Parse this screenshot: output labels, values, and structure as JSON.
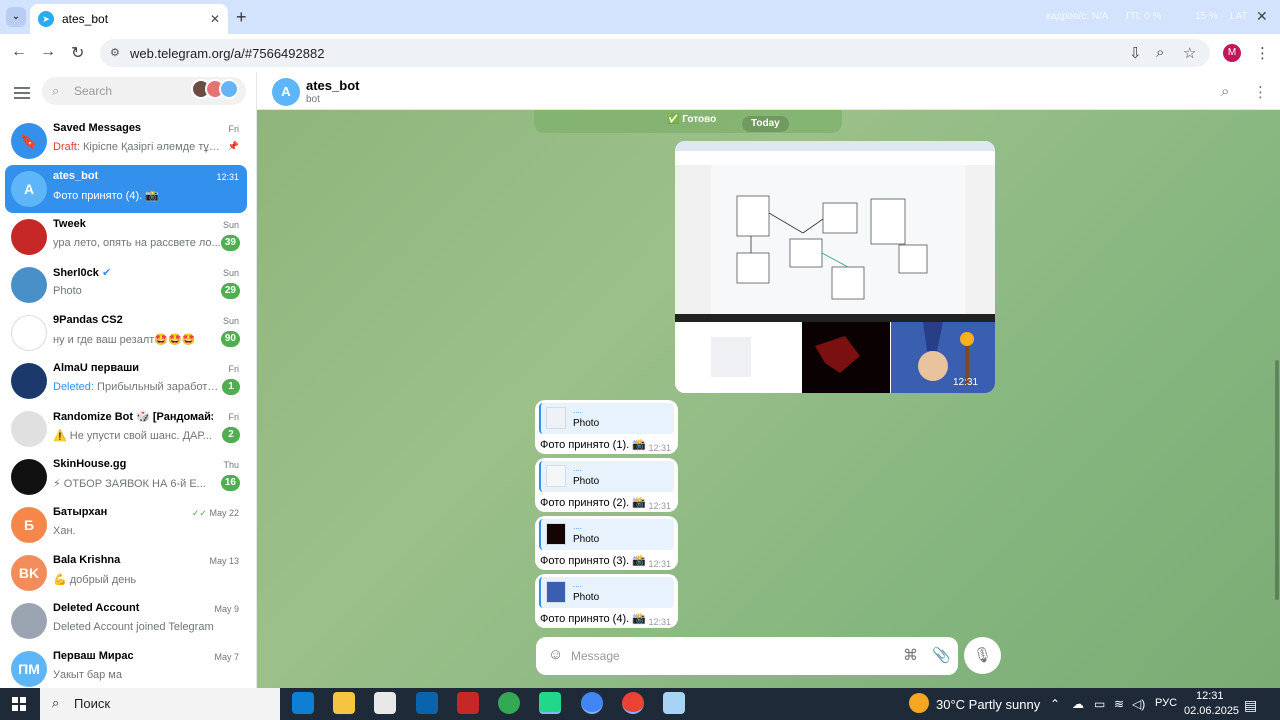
{
  "browser": {
    "tab_title": "ates_bot",
    "url": "web.telegram.org/a/#7566492882",
    "profile_initial": "M",
    "status_overlay": [
      "кадров/с: N/A",
      "ГП: 0 %",
      "15 %",
      "LAT"
    ]
  },
  "sidebar": {
    "search_placeholder": "Search",
    "chats": [
      {
        "name": "Saved Messages",
        "date": "Fri",
        "prefix": "Draft:",
        "preview": " Кіріспе Қазіргі әлемде тұр...",
        "avatar_color": "#3390ec",
        "avatar_text": "",
        "icon": "bookmark-icon"
      },
      {
        "name": "ates_bot",
        "date": "12:31",
        "preview": "Фото принято (4). 📸",
        "avatar_color": "#5eb5f7",
        "avatar_text": "A",
        "active": true
      },
      {
        "name": "Tweek",
        "date": "Sun",
        "preview": "ура лето, опять на рассвете ло...",
        "badge": "39",
        "avatar_color": "#c62828",
        "avatar_text": ""
      },
      {
        "name": "Sherl0ck",
        "date": "Sun",
        "preview": "Photo",
        "badge": "29",
        "avatar_color": "#4a90c8",
        "avatar_text": "",
        "verified": true
      },
      {
        "name": "9Pandas CS2",
        "date": "Sun",
        "preview": "ну и где ваш резалт🤩🤩🤩",
        "badge": "90",
        "avatar_color": "#ffffff",
        "avatar_text": ""
      },
      {
        "name": "AlmaU перваши",
        "date": "Fri",
        "prefix": "Deleted:",
        "preview": " Прибыльный заработок...",
        "badge": "1",
        "avatar_color": "#1b3a6b",
        "avatar_text": ""
      },
      {
        "name": "Randomize Bot 🎲 [Рандомайзер]",
        "date": "Fri",
        "preview": "⚠️ Не упусти свой шанс. ДАР...",
        "badge": "2",
        "avatar_color": "#e0e0e0",
        "avatar_text": ""
      },
      {
        "name": "SkinHouse.gg",
        "date": "Thu",
        "preview": "⚡ ОТБОР ЗАЯВОК НА 6-й Е...",
        "badge": "16",
        "avatar_color": "#111111",
        "avatar_text": ""
      },
      {
        "name": "Батырхан",
        "date": "May 22",
        "preview": "Хан.",
        "avatar_color": "#f6874a",
        "avatar_text": "Б",
        "read": true
      },
      {
        "name": "Bala Krishna",
        "date": "May 13",
        "preview": "💪 добрый день",
        "avatar_color": "#f28c5a",
        "avatar_text": "BK"
      },
      {
        "name": "Deleted Account",
        "date": "May 9",
        "preview": "Deleted Account joined Telegram",
        "avatar_color": "#9aa5b1",
        "avatar_text": ""
      },
      {
        "name": "Перваш Мирас",
        "date": "May 7",
        "preview": "Уакыт бар ма",
        "avatar_color": "#5eb5f7",
        "avatar_text": "ПМ"
      }
    ]
  },
  "chat": {
    "title": "ates_bot",
    "subtitle": "bot",
    "avatar_text": "A",
    "top_text": "✅ Готово",
    "date_label": "Today",
    "album_time": "12:31",
    "messages": [
      {
        "reply_dots": "....",
        "reply_label": "Photo",
        "text": "Фото принято (1). 📸",
        "time": "12:31",
        "thumb_color": "#eef2f6"
      },
      {
        "reply_dots": "....",
        "reply_label": "Photo",
        "text": "Фото принято (2). 📸",
        "time": "12:31",
        "thumb_color": "#f3f5f7"
      },
      {
        "reply_dots": "....",
        "reply_label": "Photo",
        "text": "Фото принято (3). 📸",
        "time": "12:31",
        "thumb_color": "#150404"
      },
      {
        "reply_dots": "....",
        "reply_label": "Photo",
        "text": "Фото принято (4). 📸",
        "time": "12:31",
        "thumb_color": "#3a5fb0"
      }
    ],
    "composer_placeholder": "Message"
  },
  "taskbar": {
    "search_label": "Поиск",
    "weather": "30°C  Partly sunny",
    "language": "РУС",
    "time": "12:31",
    "date": "02.06.2025"
  }
}
